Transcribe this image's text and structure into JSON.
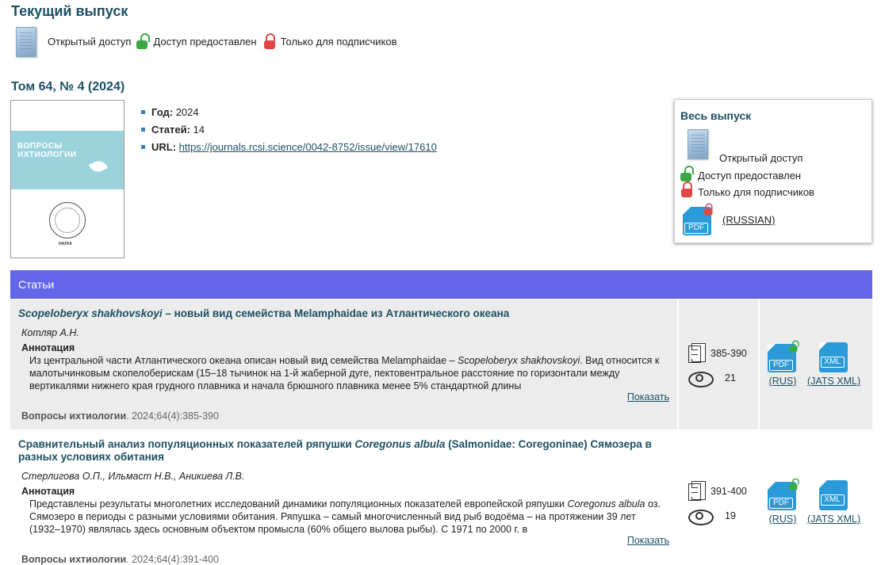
{
  "page": {
    "title": "Текущий выпуск"
  },
  "legend": {
    "open_access": "Открытый доступ",
    "access_granted": "Доступ предоставлен",
    "subscribers_only": "Только для подписчиков"
  },
  "issue": {
    "title": "Том 64, № 4 (2024)",
    "year_label": "Год:",
    "year": "2024",
    "articles_label": "Статей:",
    "articles": "14",
    "url_label": "URL:",
    "url": "https://journals.rcsi.science/0042-8752/issue/view/17610",
    "cover": {
      "journal_name_line1": "ВОПРОСЫ",
      "journal_name_line2": "ИХТИОЛОГИИ",
      "publisher": "НАУКА"
    }
  },
  "whole_issue": {
    "heading": "Весь выпуск",
    "open_access": "Открытый доступ",
    "access_granted": "Доступ предоставлен",
    "subscribers_only": "Только для подписчиков",
    "pdf_label": "PDF",
    "link": "(RUSSIAN)"
  },
  "section": {
    "title": "Статьи"
  },
  "articles": [
    {
      "title_italic": "Scopeloberyx shakhovskoyi",
      "title_rest": " – новый вид семейства Melamphaidae из Атлантического океана",
      "authors": "Котляр А.Н.",
      "annotation_label": "Аннотация",
      "annotation_part1": "Из центральной части Атлантического океана описан новый вид семейства Melamphaidae – ",
      "annotation_italic": "Scopeloberyx shakhovskoyi",
      "annotation_part2": ". Вид относится к малотычинковым скопелоберискам (15–18 тычинок на 1-й жаберной дуге, пектовентральное расстояние по горизонтали между вертикалями нижнего края грудного плавника и начала брюшного плавника менее 5% стандартной длины",
      "show": "Показать",
      "journal": "Вопросы ихтиологии",
      "citation": ". 2024;64(4):385-390",
      "pages": "385-390",
      "views": "21",
      "pdf_label": "PDF",
      "xml_label": "XML",
      "pdf_link": "(RUS)",
      "xml_link": "(JATS XML)"
    },
    {
      "title_part1": "Сравнительный анализ популяционных показателей ряпушки ",
      "title_italic": "Coregonus albula",
      "title_part2": " (Salmonidae: Coregoninae) Сямозера в разных условиях обитания",
      "authors": "Стерлигова О.П., Ильмаст Н.В., Аникиева Л.В.",
      "annotation_label": "Аннотация",
      "annotation_part1": "Представлены результаты многолетних исследований динамики популяционных показателей европейской ряпушки ",
      "annotation_italic": "Coregonus albula",
      "annotation_part2": " оз. Сямозеро в периоды с разными условиями обитания. Ряпушка – самый многочисленный вид рыб водоёма – на протяжении 39 лет (1932–1970) являлась здесь основным объектом промысла (60% общего вылова рыбы). С 1971 по 2000 г. в",
      "show": "Показать",
      "journal": "Вопросы ихтиологии",
      "citation": ". 2024;64(4):391-400",
      "pages": "391-400",
      "views": "19",
      "pdf_label": "PDF",
      "xml_label": "XML",
      "pdf_link": "(RUS)",
      "xml_link": "(JATS XML)"
    }
  ]
}
